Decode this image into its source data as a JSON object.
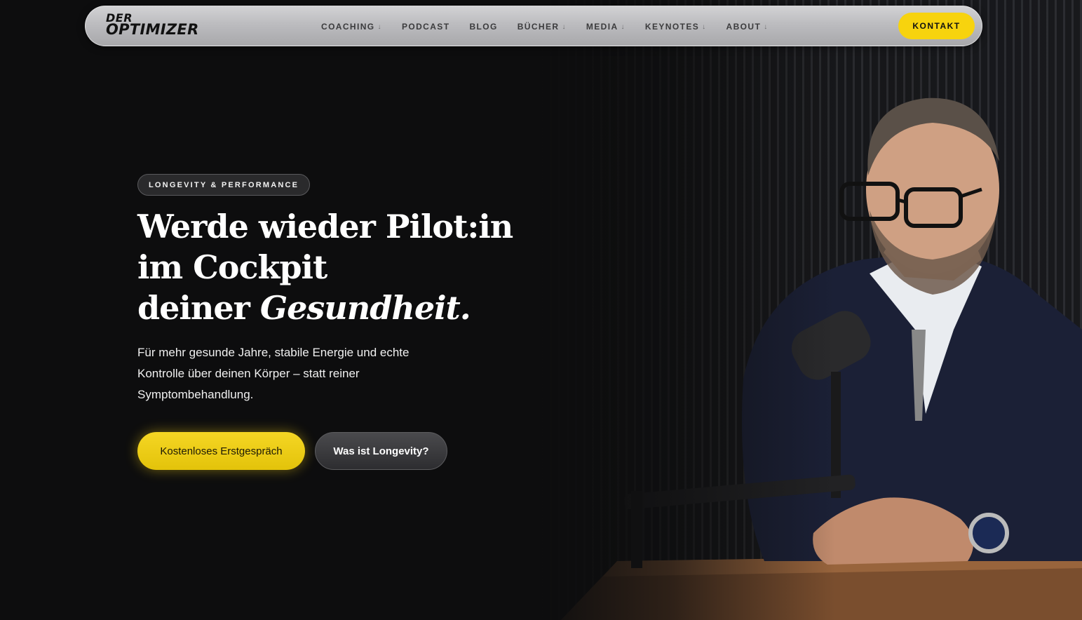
{
  "brand": {
    "line1": "DER",
    "line2": "OPTIMIZER"
  },
  "nav": {
    "items": [
      {
        "label": "COACHING",
        "caret": "↓"
      },
      {
        "label": "PODCAST",
        "caret": ""
      },
      {
        "label": "BLOG",
        "caret": ""
      },
      {
        "label": "BÜCHER",
        "caret": "↓"
      },
      {
        "label": "MEDIA",
        "caret": "↓"
      },
      {
        "label": "KEYNOTES",
        "caret": "↓"
      },
      {
        "label": "ABOUT",
        "caret": "↓"
      }
    ],
    "cta_label": "KONTAKT"
  },
  "hero": {
    "badge": "LONGEVITY & PERFORMANCE",
    "title_line1": "Werde wieder Pilot:in",
    "title_line2": "im Cockpit",
    "title_line3_plain": "deiner ",
    "title_line3_italic": "Gesundheit.",
    "subtitle": "Für mehr gesunde Jahre, stabile Energie und echte Kontrolle über deinen Körper – statt reiner Symptombehandlung.",
    "primary_button": "Kostenloses Erstgespräch",
    "secondary_button": "Was ist Longevity?"
  },
  "colors": {
    "accent": "#f7d30e",
    "background": "#0d0d0e",
    "navbar": "#bcbcbf"
  }
}
